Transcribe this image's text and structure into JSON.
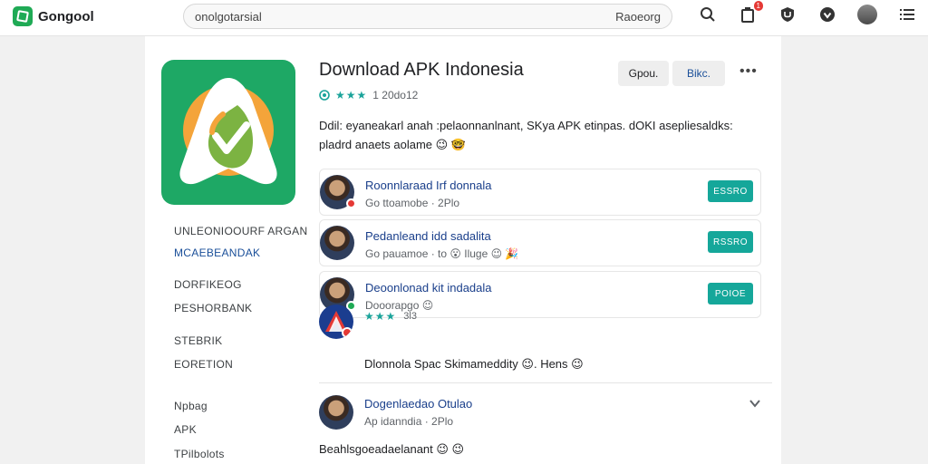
{
  "header": {
    "logo_text": "Gongool",
    "search_value": "onolgotarsial",
    "search_extra": "Raoeorg",
    "notif_badge": "1"
  },
  "app": {
    "title": "Download APK Indonesia",
    "rating_text": "1 20do12",
    "stars": "★★★",
    "button1": "Gpou.",
    "button2": "Bikc.",
    "more": "•••",
    "description_line1": "Ddil: eyaneakarl anah :pelaonnanlnant, SKya APK etinpas. dOKI asepliesaldks:",
    "description_line2": "pladrd anaets aolame 😉 🤓"
  },
  "nav": {
    "items": [
      {
        "label": "UNLEONIOOURF ARGAN",
        "active": false
      },
      {
        "label": "MCAEBEANDAK",
        "active": true
      },
      {
        "label": "DORFIKEOG",
        "active": false
      },
      {
        "label": "PESHORBANK",
        "active": false
      },
      {
        "label": "STEBRIK",
        "active": false
      },
      {
        "label": "EORETION",
        "active": false
      },
      {
        "label": "Npbag",
        "active": false
      },
      {
        "label": "APK",
        "active": false
      },
      {
        "label": "TPilbolots",
        "active": false
      }
    ]
  },
  "cards": [
    {
      "title": "Roonnlaraad Irf donnala",
      "sub": "Go ttoamobe · 2Plo",
      "button": "ESSRO",
      "status_color": "#e53935"
    },
    {
      "title": "Pedanleand idd sadalita",
      "sub": "Go pauamoe · to 😮 Iluge 😉 🎉",
      "button": "RSSRO",
      "status_color": ""
    },
    {
      "title": "Deoonlonad kit indadala",
      "sub": "Dooorapgo 😉",
      "button": "POIOE",
      "status_color": "#1faa55"
    }
  ],
  "review": {
    "stars": "★★★",
    "count": "3l3",
    "text": "Dlonnola Spac Skimameddity 😉. Hens 😉"
  },
  "comment": {
    "title": "Dogenlaedao Otulao",
    "sub": "Ap idanndia · 2Plo",
    "text": "Beahlsgoeadaelanant 😉 😉"
  },
  "colors": {
    "accent": "#15a79a",
    "link": "#1a3f8b",
    "app_green": "#1ea865"
  }
}
